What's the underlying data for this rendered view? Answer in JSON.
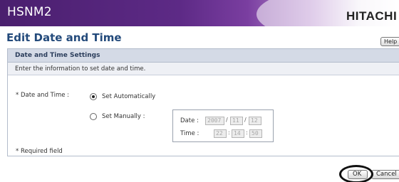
{
  "header": {
    "app_title": "HSNM2",
    "brand": "HITACHI"
  },
  "page": {
    "title": "Edit Date and Time",
    "help_label": "Help"
  },
  "panel": {
    "title": "Date and Time Settings",
    "description": "Enter the information to set date and time.",
    "field_label": "* Date and Time :",
    "options": [
      {
        "label": "Set Automatically",
        "checked": true
      },
      {
        "label": "Set Manually :",
        "checked": false
      }
    ],
    "manual": {
      "date_label": "Date :",
      "date_values": [
        "2007",
        "11",
        "12"
      ],
      "time_label": "Time :",
      "time_values": [
        "22",
        "14",
        "50"
      ]
    },
    "required_note": "* Required field"
  },
  "footer": {
    "ok_label": "OK",
    "cancel_label": "Cancel"
  },
  "colors": {
    "accent": "#234a7b",
    "header_purple": "#5d2a86",
    "panel_header": "#d4dae6"
  }
}
